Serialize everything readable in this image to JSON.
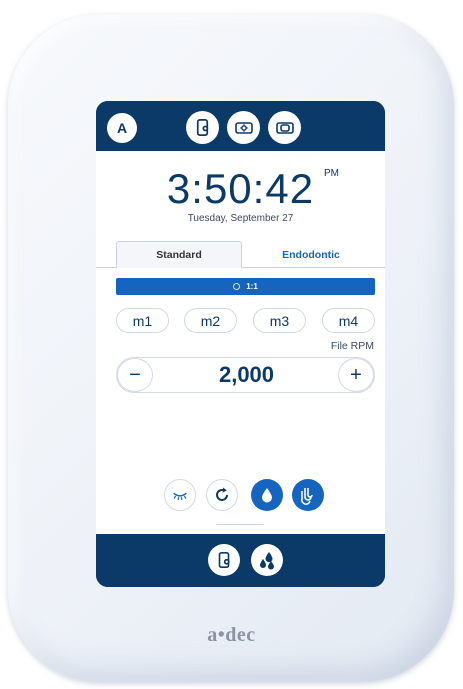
{
  "header": {
    "user_initial": "A",
    "icons": [
      "settings-device-icon",
      "light-icon",
      "camera-icon"
    ]
  },
  "clock": {
    "time": "3:50:42",
    "ampm": "PM",
    "date": "Tuesday, September 27"
  },
  "tabs": [
    {
      "label": "Standard",
      "active": true
    },
    {
      "label": "Endodontic",
      "active": false
    }
  ],
  "ratio_bar": {
    "label": "1:1"
  },
  "memory_buttons": [
    "m1",
    "m2",
    "m3",
    "m4"
  ],
  "speed": {
    "label": "File RPM",
    "value": "2,000",
    "decrement": "−",
    "increment": "+"
  },
  "tools": [
    {
      "name": "fiber-optic-light-icon",
      "active": false
    },
    {
      "name": "rotation-direction-icon",
      "active": false
    },
    {
      "name": "water-drop-icon",
      "active": true
    },
    {
      "name": "air-coolant-icon",
      "active": true
    }
  ],
  "footer": {
    "icons": [
      "device-settings-icon",
      "water-bottle-icon"
    ]
  },
  "brand": {
    "logo_text": "a•dec"
  },
  "colors": {
    "navy": "#0b3a68",
    "accent": "#1565c0"
  }
}
